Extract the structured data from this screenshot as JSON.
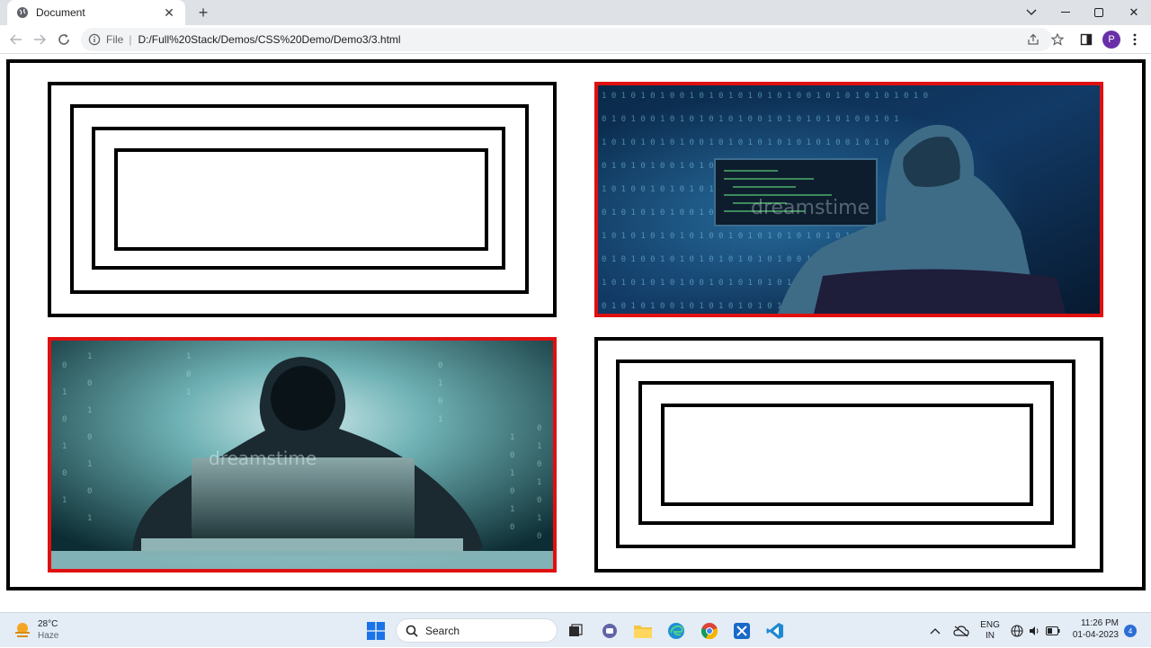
{
  "browser": {
    "tab_title": "Document",
    "url_scheme": "File",
    "url_path": "D:/Full%20Stack/Demos/CSS%20Demo/Demo3/3.html",
    "profile_initial": "P"
  },
  "page": {
    "colors": {
      "outer_border": "#000000",
      "nested_border": "#000000",
      "image_border": "#e01010"
    },
    "images": [
      {
        "name": "hacker-at-monitors-image",
        "watermark": "dreamstime"
      },
      {
        "name": "hacker-with-laptop-image",
        "watermark": "dreamstime"
      }
    ]
  },
  "taskbar": {
    "weather": {
      "temp": "28°C",
      "condition": "Haze"
    },
    "search_label": "Search",
    "lang": {
      "line1": "ENG",
      "line2": "IN"
    },
    "clock": {
      "time": "11:26 PM",
      "date": "01-04-2023"
    },
    "notification_count": "4"
  }
}
